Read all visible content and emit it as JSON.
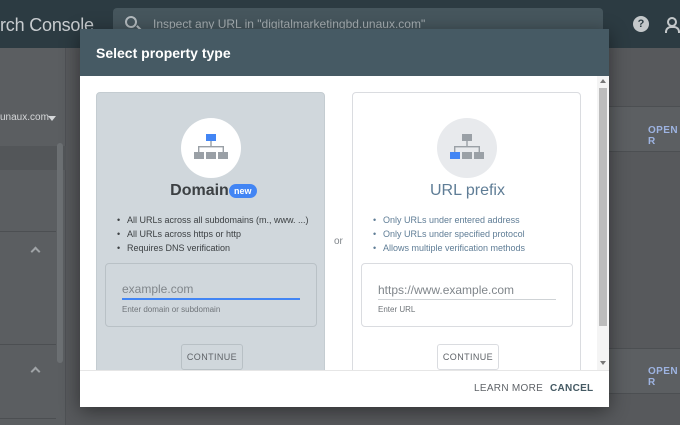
{
  "app": {
    "title": "rch Console",
    "search_placeholder": "Inspect any URL in \"digitalmarketingbd.unaux.com\"",
    "property": "unaux.com",
    "open_report_1": "OPEN R",
    "open_report_2": "OPEN R"
  },
  "modal": {
    "title": "Select property type",
    "or": "or",
    "domain": {
      "name": "Domain",
      "badge": "new",
      "bullets": [
        "All URLs across all subdomains (m., www. ...)",
        "All URLs across https or http",
        "Requires DNS verification"
      ],
      "input_placeholder": "example.com",
      "input_value": "",
      "hint": "Enter domain or subdomain",
      "continue_label": "CONTINUE"
    },
    "url_prefix": {
      "name": "URL prefix",
      "bullets": [
        "Only URLs under entered address",
        "Only URLs under specified protocol",
        "Allows multiple verification methods"
      ],
      "input_placeholder": "https://www.example.com",
      "input_value": "",
      "hint": "Enter URL",
      "continue_label": "CONTINUE"
    },
    "footer": {
      "learn_more": "LEARN MORE",
      "cancel": "CANCEL"
    }
  },
  "colors": {
    "header_bg": "#465a64",
    "accent_blue": "#4285f4",
    "domain_card_bg": "#d0d7dc"
  }
}
